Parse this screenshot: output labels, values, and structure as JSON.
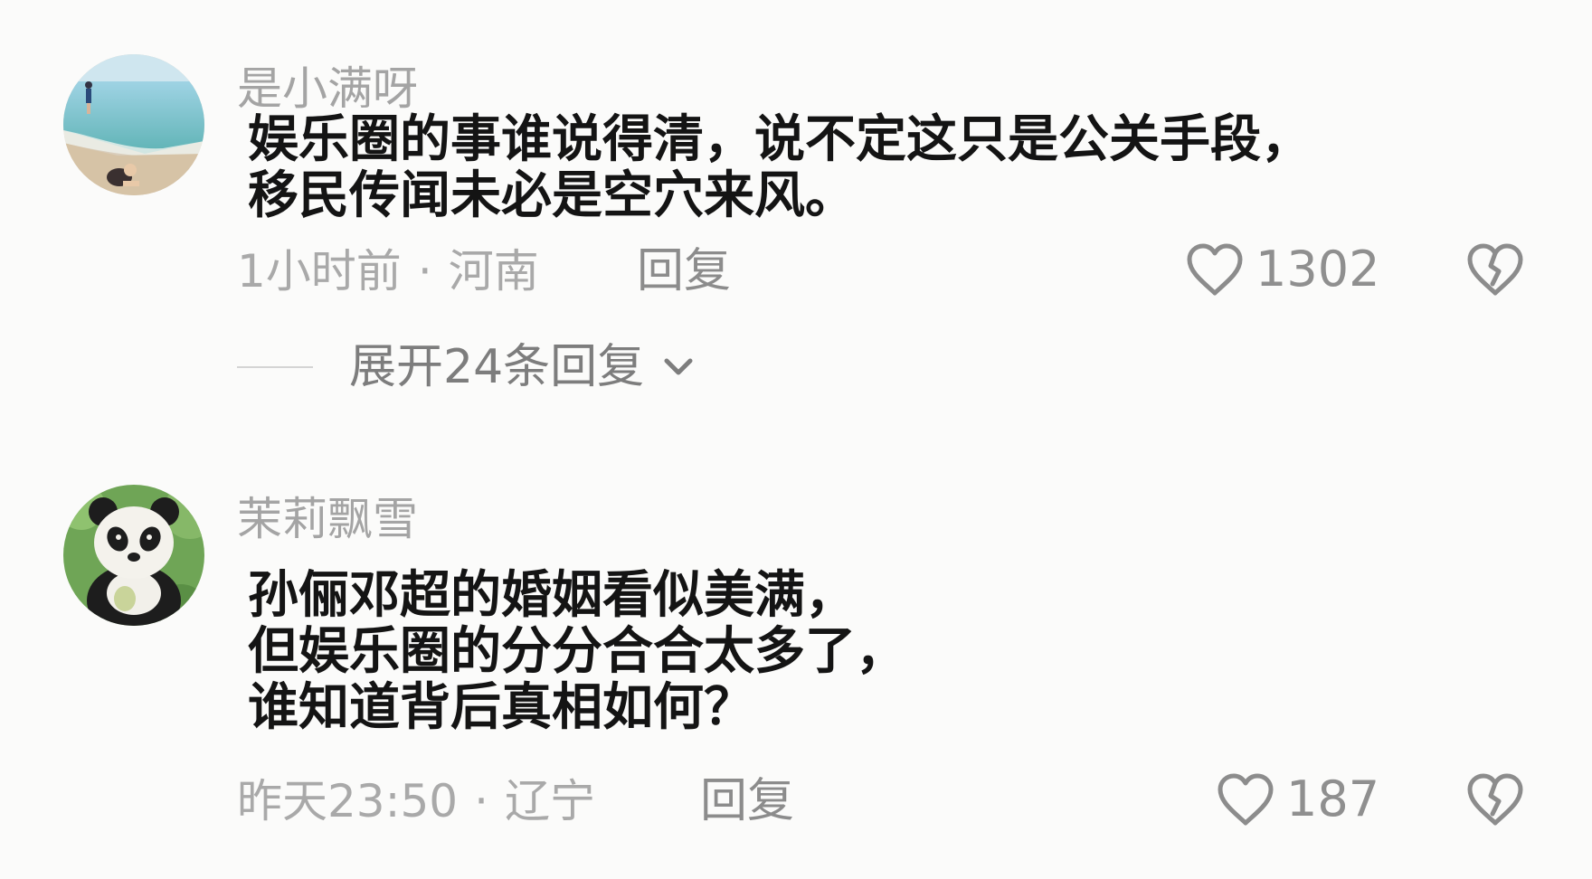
{
  "comments": [
    {
      "username": "是小满呀",
      "text_lines": [
        "娱乐圈的事谁说得清，说不定这只是公关手段，",
        "移民传闻未必是空穴来风。"
      ],
      "time": "1小时前",
      "separator": "·",
      "location": "河南",
      "reply_label": "回复",
      "like_count": "1302",
      "expand_label": "展开24条回复",
      "avatar_icon": "beach-photo-avatar-icon"
    },
    {
      "username": "茉莉飘雪",
      "text_lines": [
        "孙俪邓超的婚姻看似美满，",
        "但娱乐圈的分分合合太多了，",
        "谁知道背后真相如何？"
      ],
      "time": "昨天23:50",
      "separator": "·",
      "location": "辽宁",
      "reply_label": "回复",
      "like_count": "187",
      "avatar_icon": "panda-avatar-icon"
    }
  ],
  "icons": {
    "like": "heart-outline-icon",
    "dislike": "broken-heart-icon",
    "expand": "chevron-down-icon"
  },
  "colors": {
    "background": "#fbfbfa",
    "username": "#a4a4a4",
    "body_text": "#141414",
    "meta": "#a9a9a9",
    "icon": "#8c8c8c"
  }
}
